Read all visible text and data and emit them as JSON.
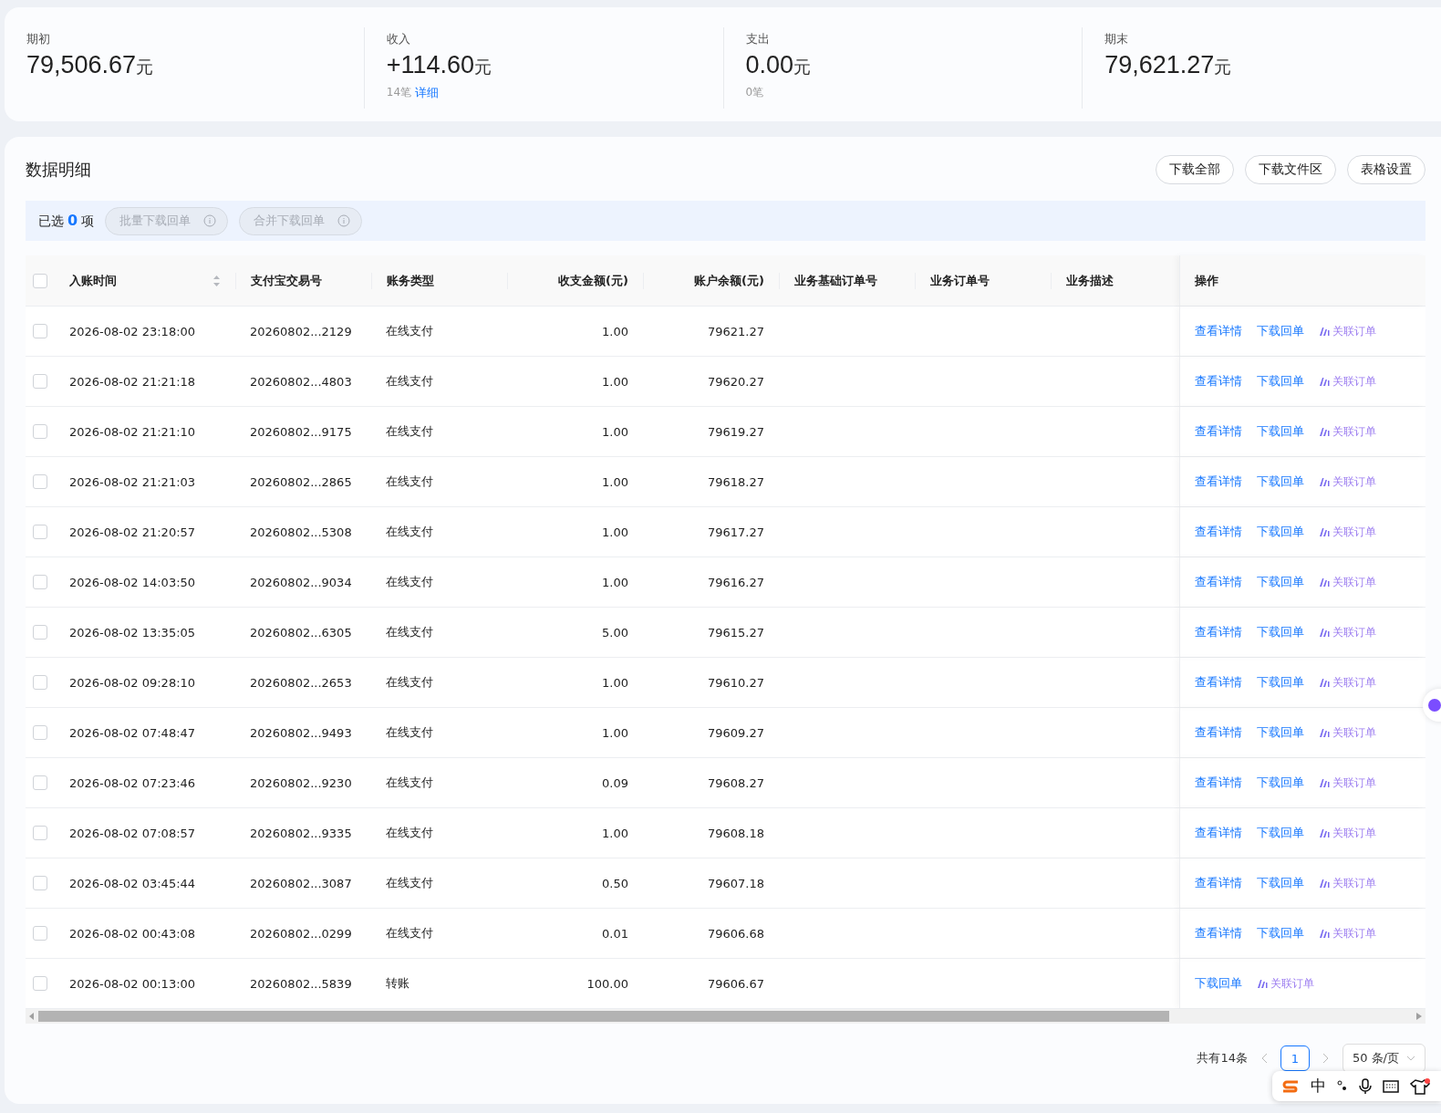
{
  "summary": [
    {
      "label": "期初",
      "amount": "79,506.67",
      "unit": "元"
    },
    {
      "label": "收入",
      "amount": "+114.60",
      "unit": "元",
      "count": "14笔",
      "link": "详细"
    },
    {
      "label": "支出",
      "amount": "0.00",
      "unit": "元",
      "count": "0笔"
    },
    {
      "label": "期末",
      "amount": "79,621.27",
      "unit": "元"
    }
  ],
  "detail": {
    "title": "数据明细",
    "buttons": [
      "下载全部",
      "下载文件区",
      "表格设置"
    ],
    "selection": {
      "prefix": "已选",
      "count": "0",
      "suffix": "项",
      "actions": [
        {
          "label": "批量下载回单",
          "disabled": true
        },
        {
          "label": "合并下载回单",
          "disabled": true
        }
      ]
    },
    "table": {
      "all_checked": false,
      "columns": [
        {
          "label": "入账时间",
          "sortable": true
        },
        {
          "label": "支付宝交易号"
        },
        {
          "label": "账务类型"
        },
        {
          "label": "收支金额(元)"
        },
        {
          "label": "账户余额(元)"
        },
        {
          "label": "业务基础订单号"
        },
        {
          "label": "业务订单号"
        },
        {
          "label": "业务描述"
        },
        {
          "label": "操作"
        }
      ],
      "rows": [
        {
          "checked": false,
          "cells": [
            "2026-08-02 23:18:00",
            "20260802...2129",
            "在线支付",
            "1.00",
            "79621.27"
          ],
          "actions": [
            {
              "kind": "link",
              "label": "查看详情"
            },
            {
              "kind": "link",
              "label": "下载回单"
            },
            {
              "kind": "ai",
              "label": "关联订单"
            }
          ]
        },
        {
          "checked": false,
          "cells": [
            "2026-08-02 21:21:18",
            "20260802...4803",
            "在线支付",
            "1.00",
            "79620.27"
          ],
          "actions": [
            {
              "kind": "link",
              "label": "查看详情"
            },
            {
              "kind": "link",
              "label": "下载回单"
            },
            {
              "kind": "ai",
              "label": "关联订单"
            }
          ]
        },
        {
          "checked": false,
          "cells": [
            "2026-08-02 21:21:10",
            "20260802...9175",
            "在线支付",
            "1.00",
            "79619.27"
          ],
          "actions": [
            {
              "kind": "link",
              "label": "查看详情"
            },
            {
              "kind": "link",
              "label": "下载回单"
            },
            {
              "kind": "ai",
              "label": "关联订单"
            }
          ]
        },
        {
          "checked": false,
          "cells": [
            "2026-08-02 21:21:03",
            "20260802...2865",
            "在线支付",
            "1.00",
            "79618.27"
          ],
          "actions": [
            {
              "kind": "link",
              "label": "查看详情"
            },
            {
              "kind": "link",
              "label": "下载回单"
            },
            {
              "kind": "ai",
              "label": "关联订单"
            }
          ]
        },
        {
          "checked": false,
          "cells": [
            "2026-08-02 21:20:57",
            "20260802...5308",
            "在线支付",
            "1.00",
            "79617.27"
          ],
          "actions": [
            {
              "kind": "link",
              "label": "查看详情"
            },
            {
              "kind": "link",
              "label": "下载回单"
            },
            {
              "kind": "ai",
              "label": "关联订单"
            }
          ]
        },
        {
          "checked": false,
          "cells": [
            "2026-08-02 14:03:50",
            "20260802...9034",
            "在线支付",
            "1.00",
            "79616.27"
          ],
          "actions": [
            {
              "kind": "link",
              "label": "查看详情"
            },
            {
              "kind": "link",
              "label": "下载回单"
            },
            {
              "kind": "ai",
              "label": "关联订单"
            }
          ]
        },
        {
          "checked": false,
          "cells": [
            "2026-08-02 13:35:05",
            "20260802...6305",
            "在线支付",
            "5.00",
            "79615.27"
          ],
          "actions": [
            {
              "kind": "link",
              "label": "查看详情"
            },
            {
              "kind": "link",
              "label": "下载回单"
            },
            {
              "kind": "ai",
              "label": "关联订单"
            }
          ]
        },
        {
          "checked": false,
          "cells": [
            "2026-08-02 09:28:10",
            "20260802...2653",
            "在线支付",
            "1.00",
            "79610.27"
          ],
          "actions": [
            {
              "kind": "link",
              "label": "查看详情"
            },
            {
              "kind": "link",
              "label": "下载回单"
            },
            {
              "kind": "ai",
              "label": "关联订单"
            }
          ]
        },
        {
          "checked": false,
          "cells": [
            "2026-08-02 07:48:47",
            "20260802...9493",
            "在线支付",
            "1.00",
            "79609.27"
          ],
          "actions": [
            {
              "kind": "link",
              "label": "查看详情"
            },
            {
              "kind": "link",
              "label": "下载回单"
            },
            {
              "kind": "ai",
              "label": "关联订单"
            }
          ]
        },
        {
          "checked": false,
          "cells": [
            "2026-08-02 07:23:46",
            "20260802...9230",
            "在线支付",
            "0.09",
            "79608.27"
          ],
          "actions": [
            {
              "kind": "link",
              "label": "查看详情"
            },
            {
              "kind": "link",
              "label": "下载回单"
            },
            {
              "kind": "ai",
              "label": "关联订单"
            }
          ]
        },
        {
          "checked": false,
          "cells": [
            "2026-08-02 07:08:57",
            "20260802...9335",
            "在线支付",
            "1.00",
            "79608.18"
          ],
          "actions": [
            {
              "kind": "link",
              "label": "查看详情"
            },
            {
              "kind": "link",
              "label": "下载回单"
            },
            {
              "kind": "ai",
              "label": "关联订单"
            }
          ]
        },
        {
          "checked": false,
          "cells": [
            "2026-08-02 03:45:44",
            "20260802...3087",
            "在线支付",
            "0.50",
            "79607.18"
          ],
          "actions": [
            {
              "kind": "link",
              "label": "查看详情"
            },
            {
              "kind": "link",
              "label": "下载回单"
            },
            {
              "kind": "ai",
              "label": "关联订单"
            }
          ]
        },
        {
          "checked": false,
          "cells": [
            "2026-08-02 00:43:08",
            "20260802...0299",
            "在线支付",
            "0.01",
            "79606.68"
          ],
          "actions": [
            {
              "kind": "link",
              "label": "查看详情"
            },
            {
              "kind": "link",
              "label": "下载回单"
            },
            {
              "kind": "ai",
              "label": "关联订单"
            }
          ]
        },
        {
          "checked": false,
          "cells": [
            "2026-08-02 00:13:00",
            "20260802...5839",
            "转账",
            "100.00",
            "79606.67"
          ],
          "actions": [
            {
              "kind": "link",
              "label": "下载回单"
            },
            {
              "kind": "ai",
              "label": "关联订单"
            }
          ]
        }
      ]
    },
    "pagination": {
      "total": "共有14条",
      "pages": [
        {
          "label": "1",
          "selected": true
        }
      ],
      "page_size": "50 条/页"
    }
  },
  "ime_bar": {
    "mode": "中"
  }
}
